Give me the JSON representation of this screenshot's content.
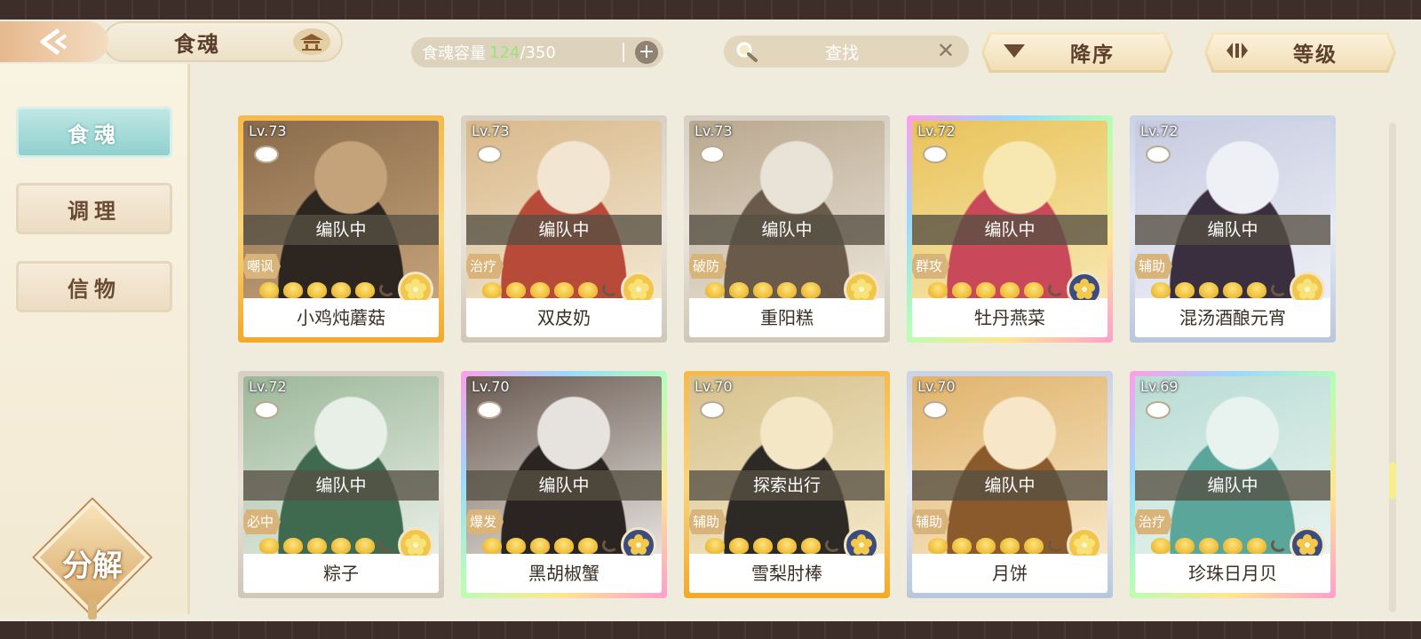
{
  "header": {
    "title": "食魂",
    "capacity_label": "食魂容量",
    "capacity_current": "124",
    "capacity_separator": "/",
    "capacity_max": "350",
    "search_placeholder": "查找",
    "sort_label": "降序",
    "level_label": "等级"
  },
  "sidebar": {
    "tabs": [
      {
        "label": "食魂",
        "active": true
      },
      {
        "label": "调理",
        "active": false
      },
      {
        "label": "信物",
        "active": false
      }
    ],
    "decompose_label": "分解"
  },
  "cards": [
    {
      "level": "Lv.73",
      "status": "编队中",
      "tag": "嘲讽",
      "name": "小鸡炖蘑菇",
      "frame": "gold",
      "medal": "gold-flower",
      "stars": 5
    },
    {
      "level": "Lv.73",
      "status": "编队中",
      "tag": "治疗",
      "name": "双皮奶",
      "frame": "silver",
      "medal": "gold-flower",
      "stars": 5
    },
    {
      "level": "Lv.73",
      "status": "编队中",
      "tag": "破防",
      "name": "重阳糕",
      "frame": "silver",
      "medal": "gold-flower",
      "stars": 5
    },
    {
      "level": "Lv.72",
      "status": "编队中",
      "tag": "群攻",
      "name": "牡丹燕菜",
      "frame": "rainbow",
      "medal": "blue-flower",
      "stars": 5
    },
    {
      "level": "Lv.72",
      "status": "编队中",
      "tag": "辅助",
      "name": "混汤酒酿元宵",
      "frame": "blue",
      "medal": "gold-flower",
      "stars": 5
    },
    {
      "level": "Lv.72",
      "status": "编队中",
      "tag": "必中",
      "name": "粽子",
      "frame": "silver",
      "medal": "gold-flower",
      "stars": 5
    },
    {
      "level": "Lv.70",
      "status": "编队中",
      "tag": "爆发",
      "name": "黑胡椒蟹",
      "frame": "rainbow",
      "medal": "blue-flower",
      "stars": 5
    },
    {
      "level": "Lv.70",
      "status": "探索出行",
      "tag": "辅助",
      "name": "雪梨肘棒",
      "frame": "gold",
      "medal": "blue-flower",
      "stars": 5
    },
    {
      "level": "Lv.70",
      "status": "编队中",
      "tag": "辅助",
      "name": "月饼",
      "frame": "blue",
      "medal": "gold-flower",
      "stars": 5
    },
    {
      "level": "Lv.69",
      "status": "编队中",
      "tag": "治疗",
      "name": "珍珠日月贝",
      "frame": "rainbow",
      "medal": "blue-flower",
      "stars": 5
    }
  ],
  "scroll_position": 0.75,
  "colors": {
    "accent_teal": "#8fd0cf",
    "capacity_green": "#9be37a",
    "gold": "#e4a91c",
    "text_brown": "#5c3f2b"
  }
}
